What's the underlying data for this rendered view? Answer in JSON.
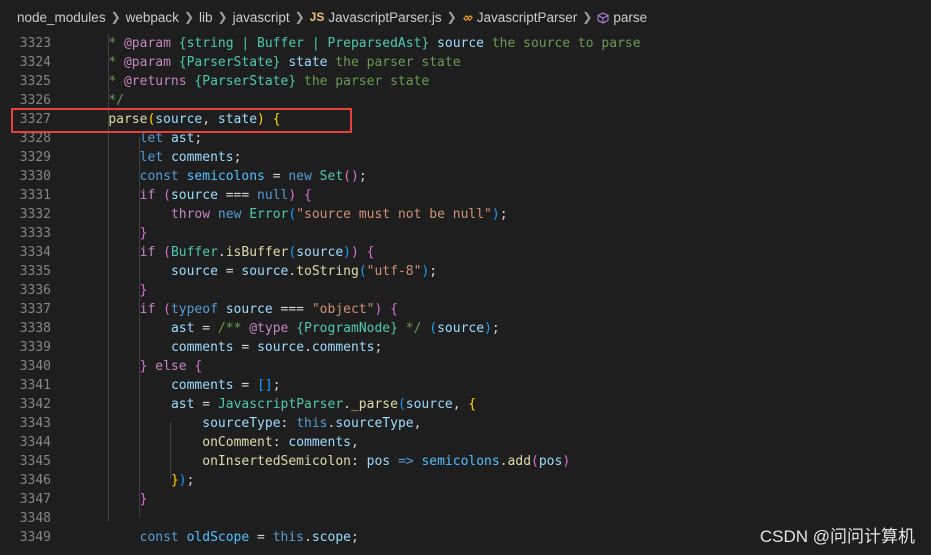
{
  "breadcrumb": {
    "items": [
      "node_modules",
      "webpack",
      "lib",
      "javascript"
    ],
    "file_badge": "JS",
    "file": "JavascriptParser.js",
    "class": "JavascriptParser",
    "method": "parse"
  },
  "code_lines": [
    {
      "n": "3323",
      "indent": 4,
      "tokens": [
        [
          "* ",
          "cm"
        ],
        [
          "@param",
          "tag"
        ],
        [
          " ",
          "cm"
        ],
        [
          "{string | Buffer | PreparsedAst}",
          "type"
        ],
        [
          " ",
          "cm"
        ],
        [
          "source",
          "pname"
        ],
        [
          " the source to parse",
          "cm"
        ]
      ]
    },
    {
      "n": "3324",
      "indent": 4,
      "tokens": [
        [
          "* ",
          "cm"
        ],
        [
          "@param",
          "tag"
        ],
        [
          " ",
          "cm"
        ],
        [
          "{ParserState}",
          "type"
        ],
        [
          " ",
          "cm"
        ],
        [
          "state",
          "pname"
        ],
        [
          " the parser state",
          "cm"
        ]
      ]
    },
    {
      "n": "3325",
      "indent": 4,
      "tokens": [
        [
          "* ",
          "cm"
        ],
        [
          "@returns",
          "tag"
        ],
        [
          " ",
          "cm"
        ],
        [
          "{ParserState}",
          "type"
        ],
        [
          " the parser state",
          "cm"
        ]
      ]
    },
    {
      "n": "3326",
      "indent": 4,
      "tokens": [
        [
          "*/",
          "cm"
        ]
      ]
    },
    {
      "n": "3327",
      "indent": 4,
      "tokens": [
        [
          "parse",
          "fn"
        ],
        [
          "(",
          "p1"
        ],
        [
          "source",
          "var"
        ],
        [
          ", ",
          "plain"
        ],
        [
          "state",
          "var"
        ],
        [
          ")",
          "p1"
        ],
        [
          " ",
          "plain"
        ],
        [
          "{",
          "p1"
        ]
      ]
    },
    {
      "n": "3328",
      "indent": 8,
      "tokens": [
        [
          "let",
          "kw"
        ],
        [
          " ",
          "plain"
        ],
        [
          "ast",
          "var"
        ],
        [
          ";",
          "plain"
        ]
      ]
    },
    {
      "n": "3329",
      "indent": 8,
      "tokens": [
        [
          "let",
          "kw"
        ],
        [
          " ",
          "plain"
        ],
        [
          "comments",
          "var"
        ],
        [
          ";",
          "plain"
        ]
      ]
    },
    {
      "n": "3330",
      "indent": 8,
      "tokens": [
        [
          "const",
          "kw"
        ],
        [
          " ",
          "plain"
        ],
        [
          "semicolons",
          "const"
        ],
        [
          " ",
          "plain"
        ],
        [
          "=",
          "op"
        ],
        [
          " ",
          "plain"
        ],
        [
          "new",
          "kw"
        ],
        [
          " ",
          "plain"
        ],
        [
          "Set",
          "cls"
        ],
        [
          "()",
          "p2"
        ],
        [
          ";",
          "plain"
        ]
      ]
    },
    {
      "n": "3331",
      "indent": 8,
      "tokens": [
        [
          "if",
          "ctrl"
        ],
        [
          " ",
          "plain"
        ],
        [
          "(",
          "p2"
        ],
        [
          "source",
          "var"
        ],
        [
          " ",
          "plain"
        ],
        [
          "===",
          "op"
        ],
        [
          " ",
          "plain"
        ],
        [
          "null",
          "kw"
        ],
        [
          ")",
          "p2"
        ],
        [
          " ",
          "plain"
        ],
        [
          "{",
          "p2"
        ]
      ]
    },
    {
      "n": "3332",
      "indent": 12,
      "tokens": [
        [
          "throw",
          "ctrl"
        ],
        [
          " ",
          "plain"
        ],
        [
          "new",
          "kw"
        ],
        [
          " ",
          "plain"
        ],
        [
          "Error",
          "cls"
        ],
        [
          "(",
          "p3"
        ],
        [
          "\"source must not be null\"",
          "str"
        ],
        [
          ")",
          "p3"
        ],
        [
          ";",
          "plain"
        ]
      ]
    },
    {
      "n": "3333",
      "indent": 8,
      "tokens": [
        [
          "}",
          "p2"
        ]
      ]
    },
    {
      "n": "3334",
      "indent": 8,
      "tokens": [
        [
          "if",
          "ctrl"
        ],
        [
          " ",
          "plain"
        ],
        [
          "(",
          "p2"
        ],
        [
          "Buffer",
          "cls"
        ],
        [
          ".",
          "plain"
        ],
        [
          "isBuffer",
          "fn"
        ],
        [
          "(",
          "p3"
        ],
        [
          "source",
          "var"
        ],
        [
          ")",
          "p3"
        ],
        [
          ")",
          "p2"
        ],
        [
          " ",
          "plain"
        ],
        [
          "{",
          "p2"
        ]
      ]
    },
    {
      "n": "3335",
      "indent": 12,
      "tokens": [
        [
          "source",
          "var"
        ],
        [
          " ",
          "plain"
        ],
        [
          "=",
          "op"
        ],
        [
          " ",
          "plain"
        ],
        [
          "source",
          "var"
        ],
        [
          ".",
          "plain"
        ],
        [
          "toString",
          "fn"
        ],
        [
          "(",
          "p3"
        ],
        [
          "\"utf-8\"",
          "str"
        ],
        [
          ")",
          "p3"
        ],
        [
          ";",
          "plain"
        ]
      ]
    },
    {
      "n": "3336",
      "indent": 8,
      "tokens": [
        [
          "}",
          "p2"
        ]
      ]
    },
    {
      "n": "3337",
      "indent": 8,
      "tokens": [
        [
          "if",
          "ctrl"
        ],
        [
          " ",
          "plain"
        ],
        [
          "(",
          "p2"
        ],
        [
          "typeof",
          "kw"
        ],
        [
          " ",
          "plain"
        ],
        [
          "source",
          "var"
        ],
        [
          " ",
          "plain"
        ],
        [
          "===",
          "op"
        ],
        [
          " ",
          "plain"
        ],
        [
          "\"object\"",
          "str"
        ],
        [
          ")",
          "p2"
        ],
        [
          " ",
          "plain"
        ],
        [
          "{",
          "p2"
        ]
      ]
    },
    {
      "n": "3338",
      "indent": 12,
      "tokens": [
        [
          "ast",
          "var"
        ],
        [
          " ",
          "plain"
        ],
        [
          "=",
          "op"
        ],
        [
          " ",
          "plain"
        ],
        [
          "/** ",
          "cm"
        ],
        [
          "@type",
          "tag"
        ],
        [
          " ",
          "cm"
        ],
        [
          "{ProgramNode}",
          "type"
        ],
        [
          " */",
          "cm"
        ],
        [
          " ",
          "plain"
        ],
        [
          "(",
          "p3"
        ],
        [
          "source",
          "var"
        ],
        [
          ")",
          "p3"
        ],
        [
          ";",
          "plain"
        ]
      ]
    },
    {
      "n": "3339",
      "indent": 12,
      "tokens": [
        [
          "comments",
          "var"
        ],
        [
          " ",
          "plain"
        ],
        [
          "=",
          "op"
        ],
        [
          " ",
          "plain"
        ],
        [
          "source",
          "var"
        ],
        [
          ".",
          "plain"
        ],
        [
          "comments",
          "prop"
        ],
        [
          ";",
          "plain"
        ]
      ]
    },
    {
      "n": "3340",
      "indent": 8,
      "tokens": [
        [
          "}",
          "p2"
        ],
        [
          " ",
          "plain"
        ],
        [
          "else",
          "ctrl"
        ],
        [
          " ",
          "plain"
        ],
        [
          "{",
          "p2"
        ]
      ]
    },
    {
      "n": "3341",
      "indent": 12,
      "tokens": [
        [
          "comments",
          "var"
        ],
        [
          " ",
          "plain"
        ],
        [
          "=",
          "op"
        ],
        [
          " ",
          "plain"
        ],
        [
          "[]",
          "p3"
        ],
        [
          ";",
          "plain"
        ]
      ]
    },
    {
      "n": "3342",
      "indent": 12,
      "tokens": [
        [
          "ast",
          "var"
        ],
        [
          " ",
          "plain"
        ],
        [
          "=",
          "op"
        ],
        [
          " ",
          "plain"
        ],
        [
          "JavascriptParser",
          "cls"
        ],
        [
          ".",
          "plain"
        ],
        [
          "_parse",
          "fn"
        ],
        [
          "(",
          "p3"
        ],
        [
          "source",
          "var"
        ],
        [
          ", ",
          "plain"
        ],
        [
          "{",
          "p1"
        ]
      ]
    },
    {
      "n": "3343",
      "indent": 16,
      "tokens": [
        [
          "sourceType",
          "prop"
        ],
        [
          ": ",
          "plain"
        ],
        [
          "this",
          "kw"
        ],
        [
          ".",
          "plain"
        ],
        [
          "sourceType",
          "prop"
        ],
        [
          ",",
          "plain"
        ]
      ]
    },
    {
      "n": "3344",
      "indent": 16,
      "tokens": [
        [
          "onComment",
          "fn"
        ],
        [
          ": ",
          "plain"
        ],
        [
          "comments",
          "var"
        ],
        [
          ",",
          "plain"
        ]
      ]
    },
    {
      "n": "3345",
      "indent": 16,
      "tokens": [
        [
          "onInsertedSemicolon",
          "fn"
        ],
        [
          ": ",
          "plain"
        ],
        [
          "pos",
          "var"
        ],
        [
          " ",
          "plain"
        ],
        [
          "=>",
          "kw"
        ],
        [
          " ",
          "plain"
        ],
        [
          "semicolons",
          "const"
        ],
        [
          ".",
          "plain"
        ],
        [
          "add",
          "fn"
        ],
        [
          "(",
          "p2"
        ],
        [
          "pos",
          "var"
        ],
        [
          ")",
          "p2"
        ]
      ]
    },
    {
      "n": "3346",
      "indent": 12,
      "tokens": [
        [
          "}",
          "p1"
        ],
        [
          ")",
          "p3"
        ],
        [
          ";",
          "plain"
        ]
      ]
    },
    {
      "n": "3347",
      "indent": 8,
      "tokens": [
        [
          "}",
          "p2"
        ]
      ]
    },
    {
      "n": "3348",
      "indent": 0,
      "tokens": []
    },
    {
      "n": "3349",
      "indent": 8,
      "tokens": [
        [
          "const",
          "kw"
        ],
        [
          " ",
          "plain"
        ],
        [
          "oldScope",
          "const"
        ],
        [
          " ",
          "plain"
        ],
        [
          "=",
          "op"
        ],
        [
          " ",
          "plain"
        ],
        [
          "this",
          "kw"
        ],
        [
          ".",
          "plain"
        ],
        [
          "scope",
          "prop"
        ],
        [
          ";",
          "plain"
        ]
      ]
    }
  ],
  "highlighted_line": "3327",
  "watermark": "CSDN @问问计算机",
  "colors": {
    "background": "#1e1e1e",
    "line_number": "#858585",
    "highlight_border": "#e8403e"
  }
}
